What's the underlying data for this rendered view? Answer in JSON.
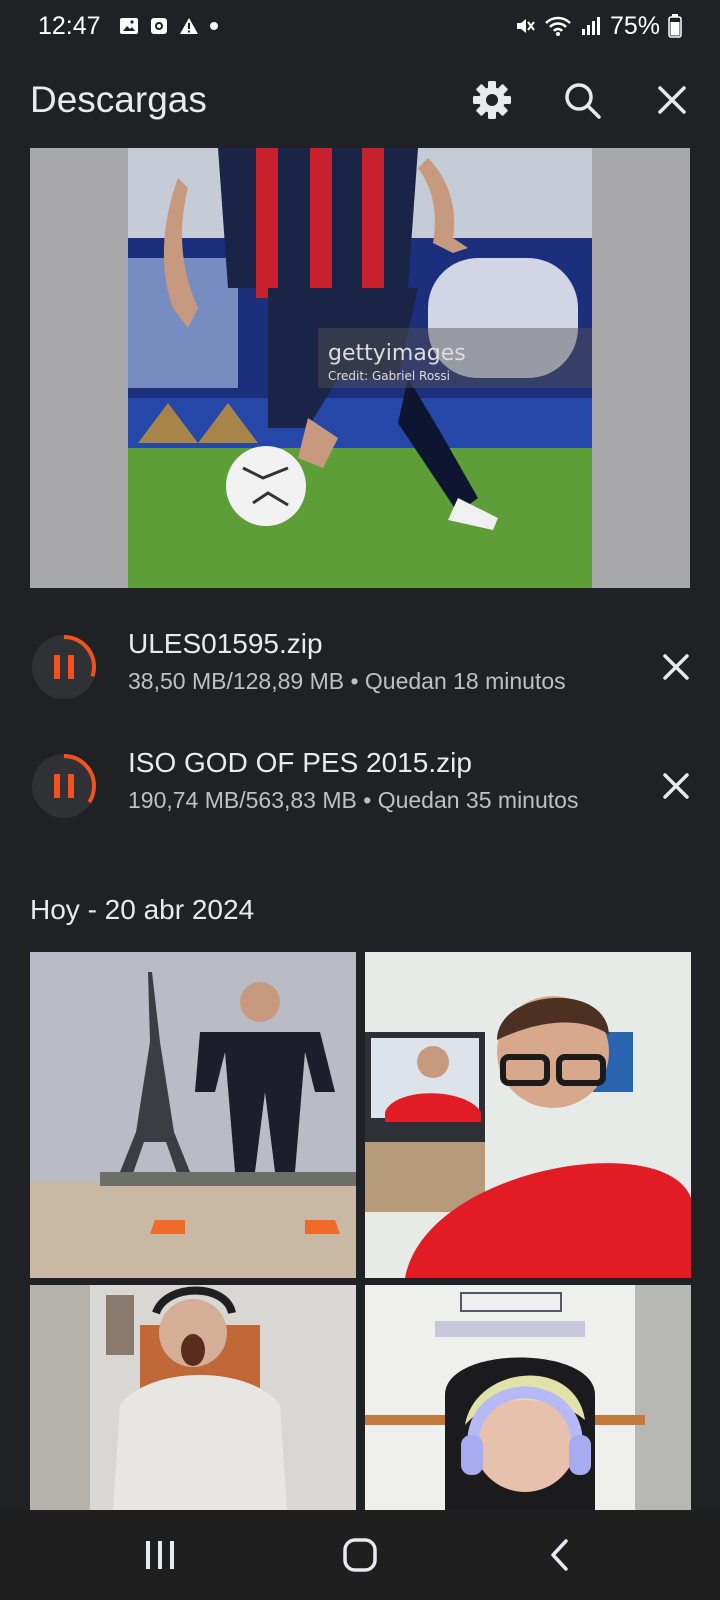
{
  "status_bar": {
    "time": "12:47",
    "battery": "75%",
    "icons": [
      "gallery-icon",
      "camera-icon",
      "warning-icon",
      "dot-icon",
      "mute-icon",
      "wifi-icon",
      "signal-icon",
      "battery-icon"
    ]
  },
  "app_bar": {
    "title": "Descargas",
    "actions": [
      "settings-icon",
      "search-icon",
      "close-icon"
    ]
  },
  "preview": {
    "watermark": "gettyimages",
    "credit": "Credit: Gabriel Rossi"
  },
  "downloads": [
    {
      "name": "ULES01595.zip",
      "meta": "38,50 MB/128,89 MB • Quedan 18 minutos",
      "progress": 0.3,
      "state": "paused"
    },
    {
      "name": "ISO GOD OF PES 2015.zip",
      "meta": "190,74 MB/563,83 MB • Quedan 35 minutos",
      "progress": 0.34,
      "state": "paused"
    }
  ],
  "section": {
    "date_header": "Hoy - 20 abr 2024"
  },
  "colors": {
    "background": "#202124",
    "accent": "#f4511e",
    "text_primary": "#e8eaed",
    "text_secondary": "#bdc1c6"
  },
  "nav_bar": {
    "buttons": [
      "recents-icon",
      "home-icon",
      "back-icon"
    ]
  }
}
